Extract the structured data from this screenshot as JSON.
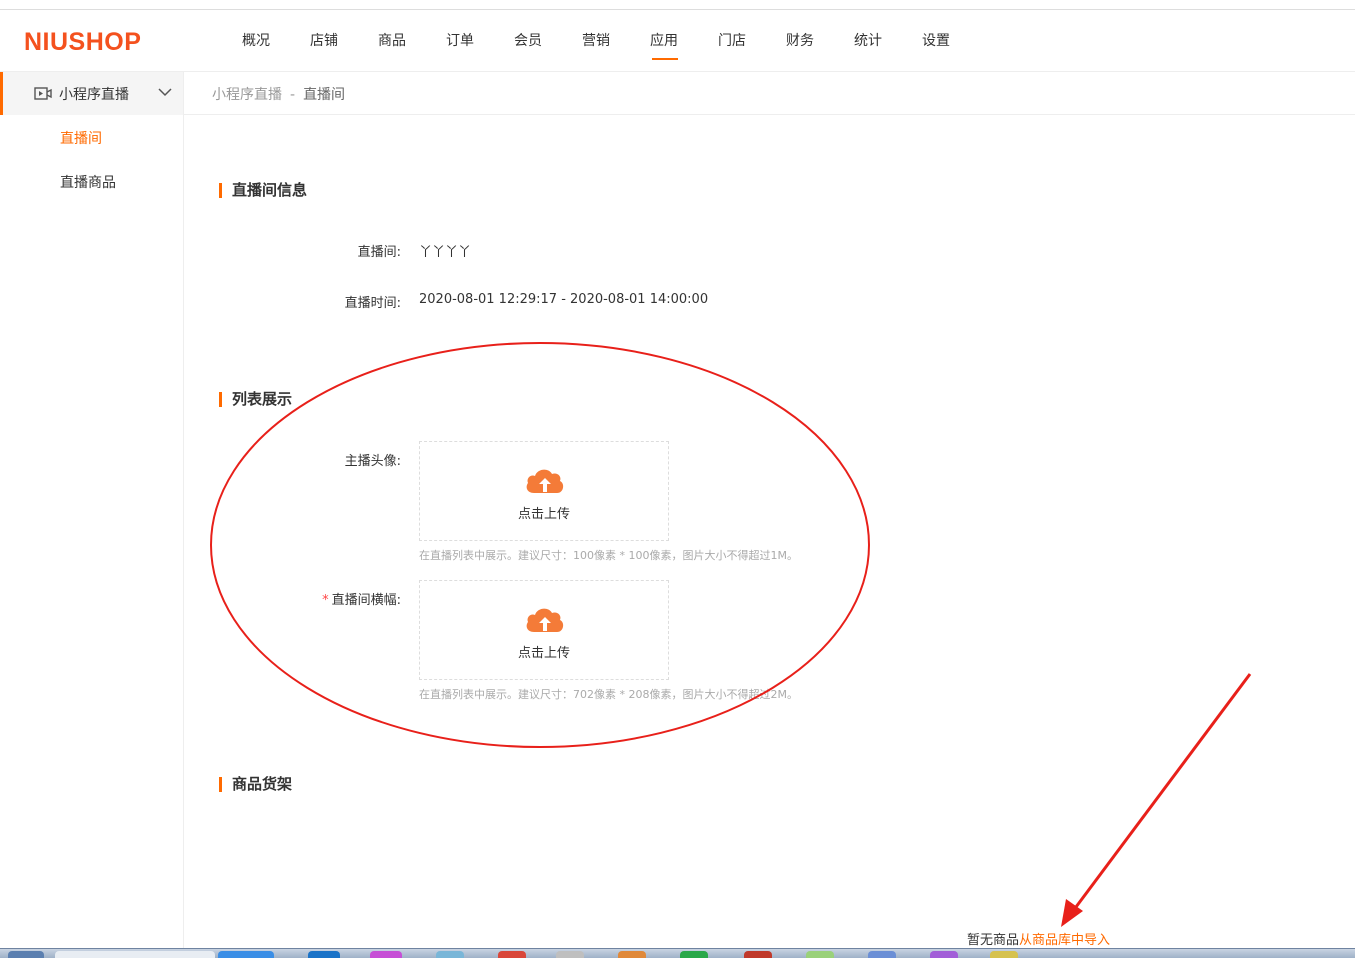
{
  "logo": "NIUSHOP",
  "nav": [
    "概况",
    "店铺",
    "商品",
    "订单",
    "会员",
    "营销",
    "应用",
    "门店",
    "财务",
    "统计",
    "设置"
  ],
  "nav_active": "应用",
  "sidebar": {
    "group_label": "小程序直播",
    "items": [
      {
        "label": "直播间",
        "active": true
      },
      {
        "label": "直播商品",
        "active": false
      }
    ]
  },
  "breadcrumb": {
    "parent": "小程序直播",
    "separator": "-",
    "current": "直播间"
  },
  "sections": {
    "info": {
      "title": "直播间信息",
      "room_label": "直播间:",
      "room_value": "丫丫丫丫",
      "time_label": "直播时间:",
      "time_value": "2020-08-01 12:29:17 - 2020-08-01 14:00:00"
    },
    "list": {
      "title": "列表展示",
      "avatar_label": "主播头像:",
      "avatar_upload": "点击上传",
      "avatar_tip": "在直播列表中展示。建议尺寸：100像素 * 100像素，图片大小不得超过1M。",
      "banner_required": "*",
      "banner_label": "直播间横幅:",
      "banner_upload": "点击上传",
      "banner_tip": "在直播列表中展示。建议尺寸：702像素 * 208像素，图片大小不得超过2M。"
    },
    "shelf": {
      "title": "商品货架",
      "empty_text": "暂无商品",
      "import_link": "从商品库中导入"
    }
  },
  "colors": {
    "accent": "#ff6a00",
    "logo": "#f4511e",
    "annotation": "#e8201a"
  }
}
